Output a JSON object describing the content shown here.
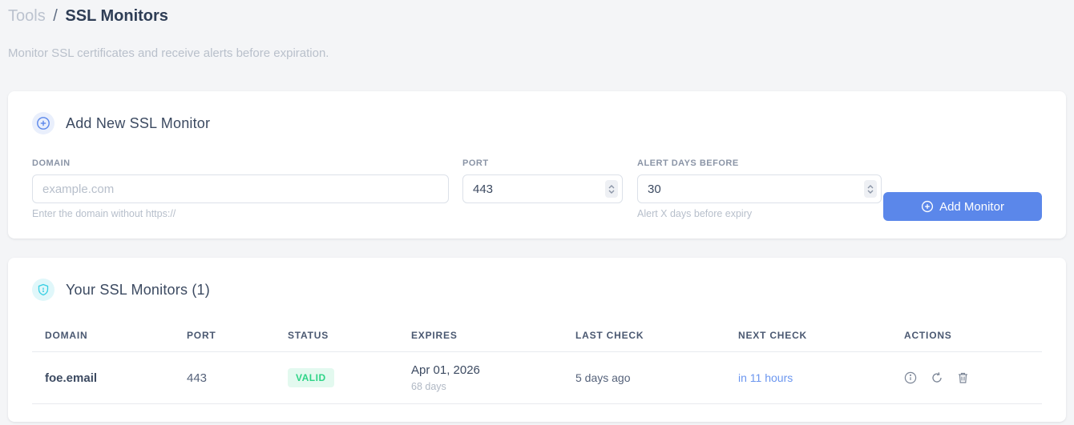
{
  "breadcrumb": {
    "section": "Tools",
    "separator": "/",
    "current": "SSL Monitors"
  },
  "subtitle": "Monitor SSL certificates and receive alerts before expiration.",
  "add_card": {
    "title": "Add New SSL Monitor",
    "domain": {
      "label": "DOMAIN",
      "placeholder": "example.com",
      "helper": "Enter the domain without https://"
    },
    "port": {
      "label": "PORT",
      "value": "443"
    },
    "alert_days": {
      "label": "ALERT DAYS BEFORE",
      "value": "30",
      "helper": "Alert X days before expiry"
    },
    "submit_label": "Add Monitor"
  },
  "monitors_card": {
    "title": "Your SSL Monitors (1)",
    "table": {
      "headers": [
        "DOMAIN",
        "PORT",
        "STATUS",
        "EXPIRES",
        "LAST CHECK",
        "NEXT CHECK",
        "ACTIONS"
      ],
      "rows": [
        {
          "domain": "foe.email",
          "port": "443",
          "status": "VALID",
          "expires_date": "Apr 01, 2026",
          "expires_sub": "68 days",
          "last_check": "5 days ago",
          "next_check": "in 11 hours"
        }
      ]
    }
  },
  "icons": {
    "add_header": "plus-circle-icon",
    "monitors_header": "shield-icon",
    "button": "plus-circle-icon",
    "actions": [
      "info-icon",
      "refresh-icon",
      "trash-icon"
    ]
  },
  "colors": {
    "accent_blue": "#5b87ea",
    "link_blue": "#6b96ef",
    "badge_green_text": "#2ed487",
    "badge_green_bg": "#e3f9ef",
    "shield_cyan": "#36cfe3",
    "page_bg": "#f4f5f7"
  }
}
